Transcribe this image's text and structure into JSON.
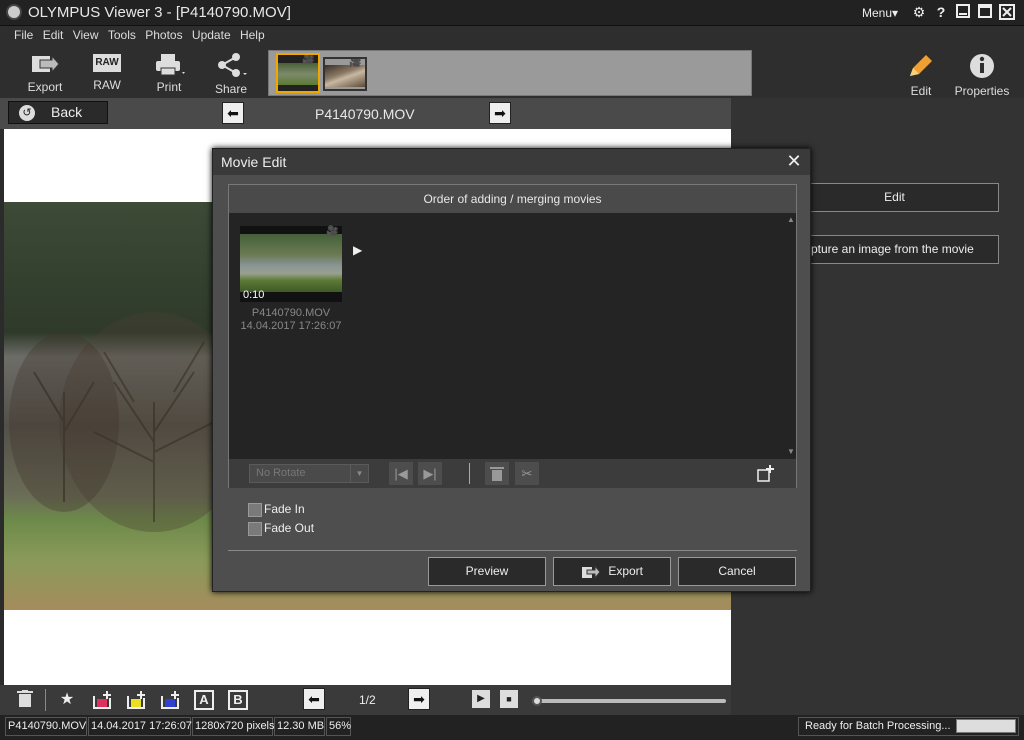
{
  "app": {
    "title": "OLYMPUS Viewer 3 - [P4140790.MOV]",
    "menu_label": "Menu▾",
    "icons": [
      "app-logo-icon",
      "gear-icon",
      "help-icon",
      "minimize-icon",
      "maximize-icon",
      "close-icon"
    ]
  },
  "menubar": {
    "items": [
      "File",
      "Edit",
      "View",
      "Tools",
      "Photos",
      "Update",
      "Help"
    ]
  },
  "toolbar": {
    "export": "Export",
    "raw": "RAW",
    "raw_badge": "RAW",
    "print": "Print",
    "share": "Share",
    "edit": "Edit",
    "properties": "Properties"
  },
  "nav": {
    "back": "Back",
    "filename": "P4140790.MOV"
  },
  "right_panel": {
    "edit_button": "Edit",
    "capture_button": "pture an image from the movie"
  },
  "bottombar": {
    "text_a": "A",
    "text_b": "B",
    "page": "1/2"
  },
  "status": {
    "filename": "P4140790.MOV",
    "datetime": "14.04.2017 17:26:07",
    "dimensions": "1280x720 pixels",
    "size": "12.30 MB",
    "zoom": "56%",
    "batch": "Ready for Batch Processing..."
  },
  "dialog": {
    "title": "Movie Edit",
    "panel_header": "Order of adding / merging movies",
    "clip": {
      "duration": "0:10",
      "name": "P4140790.MOV",
      "datetime": "14.04.2017 17:26:07"
    },
    "rotate_select": "No Rotate",
    "fade_in": "Fade In",
    "fade_out": "Fade Out",
    "preview": "Preview",
    "export": "Export",
    "cancel": "Cancel",
    "highlight_color": "#f7c400"
  }
}
